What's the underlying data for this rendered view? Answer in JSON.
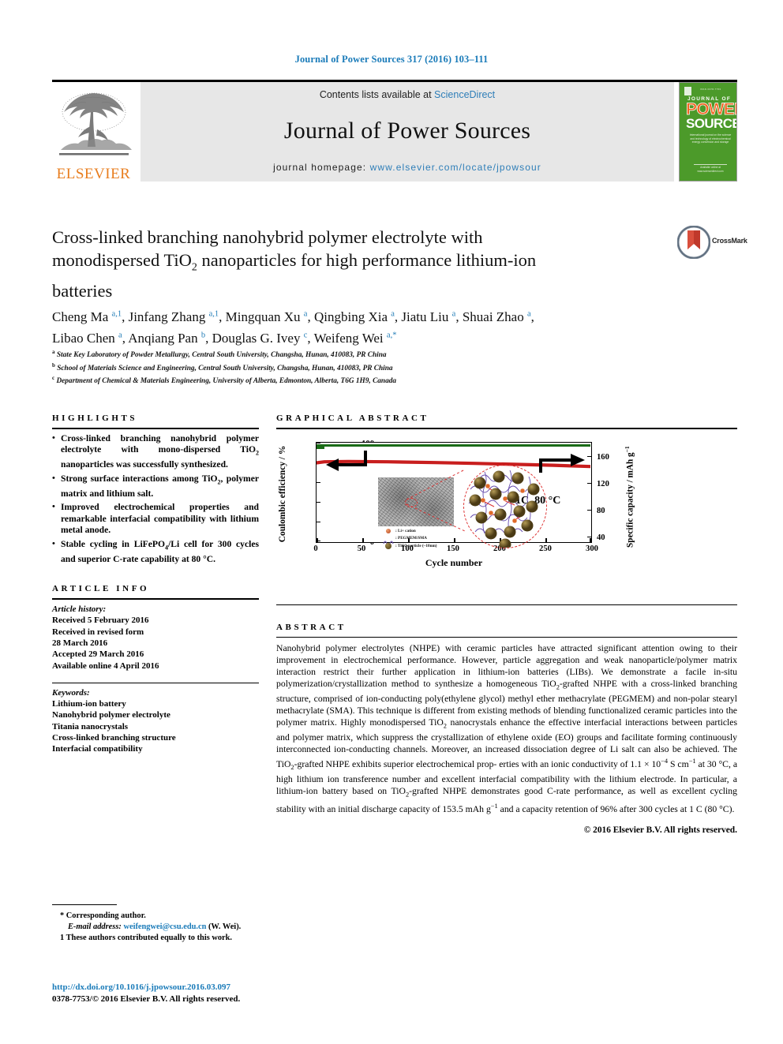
{
  "running_head": "Journal of Power Sources 317 (2016) 103–111",
  "masthead": {
    "contents_prefix": "Contents lists available at ",
    "sciencedirect": "ScienceDirect",
    "journal_title": "Journal of Power Sources",
    "homepage_prefix": "journal homepage: ",
    "homepage_url": "www.elsevier.com/locate/jpowsour",
    "publisher_wordmark": "ELSEVIER",
    "publisher_color": "#e87d1e",
    "link_color": "#2e7eb8"
  },
  "cover": {
    "line_top": "ISSN 0378-7753",
    "journal_of": "JOURNAL OF",
    "power": "POWER",
    "sources": "SOURCES",
    "subtitle": "International journal on the science and technology of electrochemical energy conversion and storage",
    "footer": "Available online at www.sciencedirect.com",
    "bg_color": "#4c9a2a",
    "accent_color": "#f26522"
  },
  "article": {
    "title_line1": "Cross-linked branching nanohybrid polymer electrolyte with",
    "title_line2_a": "monodispersed TiO",
    "title_line2_sub": "2",
    "title_line2_b": " nanoparticles for high performance lithium-ion",
    "title_line3": "batteries",
    "crossmark_label": "CrossMark",
    "authors_line1": "Cheng Ma a,1, Jinfang Zhang a,1, Mingquan Xu a, Qingbing Xia a, Jiatu Liu a, Shuai Zhao a,",
    "authors_line2": "Libao Chen a, Anqiang Pan b, Douglas G. Ivey c, Weifeng Wei a,*",
    "affiliations": [
      {
        "marker": "a",
        "text": "State Key Laboratory of Powder Metallurgy, Central South University, Changsha, Hunan, 410083, PR China"
      },
      {
        "marker": "b",
        "text": "School of Materials Science and Engineering, Central South University, Changsha, Hunan, 410083, PR China"
      },
      {
        "marker": "c",
        "text": "Department of Chemical & Materials Engineering, University of Alberta, Edmonton, Alberta, T6G 1H9, Canada"
      }
    ]
  },
  "highlights": {
    "heading": "HIGHLIGHTS",
    "items": [
      "Cross-linked branching nanohybrid polymer electrolyte with mono-dispersed TiO2 nanoparticles was successfully synthesized.",
      "Strong surface interactions among TiO2, polymer matrix and lithium salt.",
      "Improved electrochemical properties and remarkable interfacial compatibility with lithium metal anode.",
      "Stable cycling in LiFePO4/Li cell for 300 cycles and superior C-rate capability at 80 °C."
    ]
  },
  "graphical_abstract": {
    "heading": "GRAPHICAL ABSTRACT"
  },
  "chart_data": {
    "type": "line",
    "title": "",
    "annotation": "1C, 80 °C",
    "xlabel": "Cycle number",
    "ylabel_left": "Coulombic efficiency / %",
    "ylabel_right": "Specific capacity / mAh g",
    "ylabel_right_sup": "−1",
    "xlim": [
      0,
      300
    ],
    "xticks": [
      0,
      50,
      100,
      150,
      200,
      250,
      300
    ],
    "ylim_left": [
      0,
      100
    ],
    "yticks_left": [
      0,
      20,
      40,
      60,
      80,
      100
    ],
    "ylim_right": [
      40,
      170
    ],
    "yticks_right": [
      40,
      80,
      120,
      160
    ],
    "grid": false,
    "legend_position": "none",
    "series": [
      {
        "name": "Coulombic efficiency",
        "color": "#1a6b17",
        "axis": "left",
        "x": [
          1,
          25,
          50,
          100,
          150,
          200,
          250,
          300
        ],
        "values": [
          98.5,
          99.8,
          99.8,
          99.9,
          99.9,
          99.9,
          99.9,
          99.9
        ]
      },
      {
        "name": "Specific capacity",
        "color": "#c81e1e",
        "axis": "right",
        "x": [
          1,
          25,
          50,
          100,
          150,
          200,
          250,
          300
        ],
        "values": [
          153.5,
          155.0,
          155.0,
          154.0,
          153.0,
          151.5,
          150.0,
          147.4
        ]
      }
    ],
    "inset_legend": [
      {
        "symbol": "li-ion-dot",
        "label": ": Li+ cation"
      },
      {
        "symbol": "polymer-chain",
        "label": ": PEGMEM/SMA"
      },
      {
        "symbol": "tio2-sphere",
        "label": ": TiO2 particle (~10nm)"
      }
    ]
  },
  "article_info": {
    "heading": "ARTICLE INFO",
    "history_label": "Article history:",
    "history": [
      "Received 5 February 2016",
      "Received in revised form",
      "28 March 2016",
      "Accepted 29 March 2016",
      "Available online 4 April 2016"
    ],
    "keywords_label": "Keywords:",
    "keywords": [
      "Lithium-ion battery",
      "Nanohybrid polymer electrolyte",
      "Titania nanocrystals",
      "Cross-linked branching structure",
      "Interfacial compatibility"
    ]
  },
  "abstract": {
    "heading": "ABSTRACT",
    "p1": "Nanohybrid polymer electrolytes (NHPE) with ceramic particles have attracted significant attention owing to their improvement in electrochemical performance. However, particle aggregation and weak nanoparticle/polymer matrix interaction restrict their further application in lithium-ion batteries (LIBs). We demonstrate a facile in-situ polymerization/crystallization method to synthesize a homogeneous TiO2-grafted NHPE with a cross-linked branching structure, comprised of ion-conducting poly(ethylene glycol) methyl ether methacrylate (PEGMEM) and non-polar stearyl methacrylate (SMA). This technique is different from existing methods of blending functionalized ceramic particles into the polymer matrix. Highly monodispersed TiO2 nanocrystals enhance the effective interfacial interactions between particles and polymer matrix, which suppress the crystallization of ethylene oxide (EO) groups and facilitate forming continuously interconnected ion-conducting channels. Moreover, an increased dissociation degree of Li salt can also be achieved. The TiO2-grafted NHPE exhibits superior electrochemical properties with an ionic conductivity of 1.1 × 10−4 S cm−1 at 30 °C, a high lithium ion transference number and excellent interfacial compatibility with the lithium electrode. In particular, a lithium-ion battery based on TiO2-grafted NHPE demonstrates good C-rate performance, as well as excellent cycling stability with an initial discharge capacity of 153.5 mAh g−1 and a capacity retention of 96% after 300 cycles at 1 C (80 °C).",
    "copyright": "© 2016 Elsevier B.V. All rights reserved."
  },
  "footnotes": {
    "corresponding": "* Corresponding author.",
    "email_label": "E-mail address:",
    "email": "weifengwei@csu.edu.cn",
    "email_suffix": "(W. Wei).",
    "equal_contrib": "1  These authors contributed equally to this work.",
    "doi": "http://dx.doi.org/10.1016/j.jpowsour.2016.03.097",
    "issn_line": "0378-7753/© 2016 Elsevier B.V. All rights reserved."
  }
}
